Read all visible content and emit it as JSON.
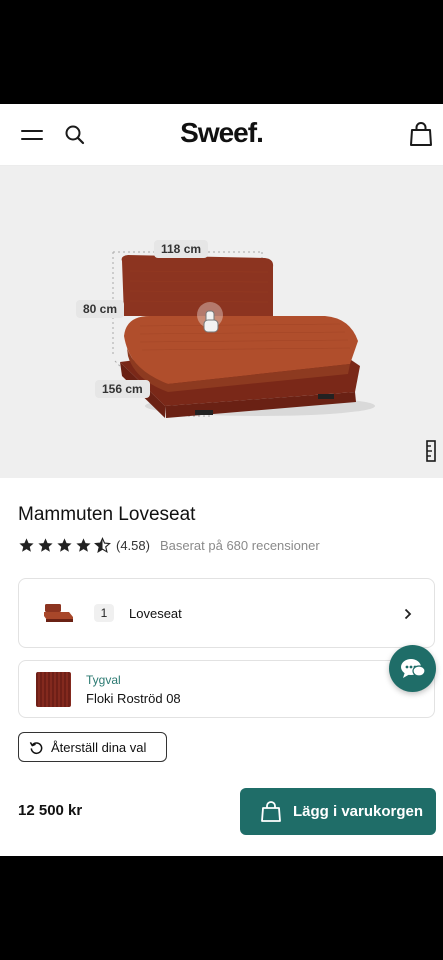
{
  "header": {
    "logo": "Sweef",
    "logo_dot": ".",
    "icons": {
      "menu": "hamburger-icon",
      "search": "search-icon",
      "cart": "shopping-bag-icon"
    }
  },
  "hero": {
    "dimensions": {
      "width": "118 cm",
      "height": "80 cm",
      "depth": "156 cm"
    },
    "icons": {
      "touch": "hand-pointer-icon",
      "measure": "ruler-icon"
    },
    "sofa_color": "#8c3420"
  },
  "product": {
    "title": "Mammuten Loveseat",
    "rating": 4.58,
    "rating_text": "(4.58)",
    "reviews_text": "Baserat på 680 recensioner"
  },
  "options": {
    "model": {
      "quantity": "1",
      "label": "Loveseat"
    },
    "fabric": {
      "label": "Tygval",
      "name": "Floki Roströd 08",
      "swatch_color": "#7a241a"
    }
  },
  "actions": {
    "reset_label": "Återställ dina val",
    "price": "12 500 kr",
    "add_to_cart_label": "Lägg i varukorgen"
  },
  "colors": {
    "accent": "#1f6d68",
    "background": "#ffffff",
    "hero_bg": "#efefef"
  }
}
